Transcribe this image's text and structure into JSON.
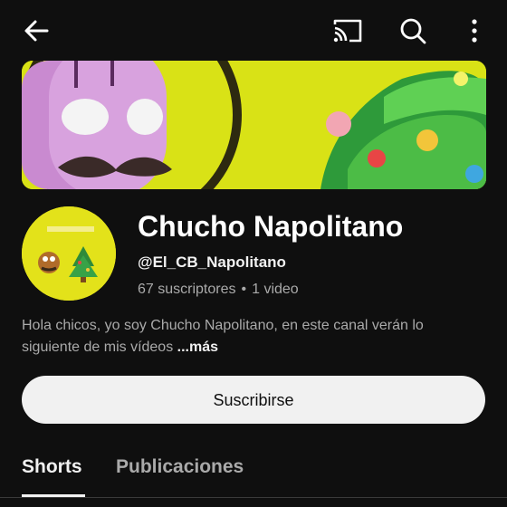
{
  "channel": {
    "name": "Chucho Napolitano",
    "handle": "@El_CB_Napolitano",
    "subscribers": "67 suscriptores",
    "separator": "•",
    "videos": "1 video",
    "description": "Hola chicos, yo soy Chucho Napolitano, en este canal verán lo siguiente de mis vídeos ",
    "more_label": "...más"
  },
  "actions": {
    "subscribe_label": "Suscribirse"
  },
  "tabs": [
    {
      "label": "Shorts",
      "selected": true
    },
    {
      "label": "Publicaciones",
      "selected": false
    }
  ],
  "icons": {
    "back": "arrow-left",
    "cast": "cast",
    "search": "magnifier",
    "more": "vertical-dots"
  },
  "colors": {
    "background": "#0f0f0f",
    "text": "#f1f1f1",
    "secondary_text": "#aaaaaa",
    "button_bg": "#f1f1f1",
    "banner_yellow": "#d9e216"
  }
}
